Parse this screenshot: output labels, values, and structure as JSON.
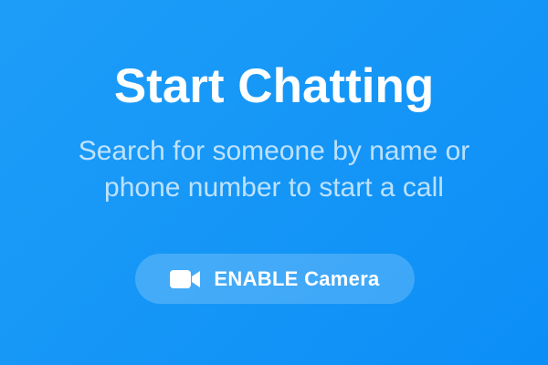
{
  "empty_state": {
    "title": "Start Chatting",
    "subtitle": "Search for someone by name or phone number to start a call"
  },
  "enable_camera_button": {
    "icon": "video-camera-icon",
    "label": "ENABLE Camera"
  },
  "colors": {
    "background": "#1697f7",
    "text": "#ffffff",
    "subtitle_text": "#bfe3fd",
    "button_fill": "#45abf8"
  }
}
